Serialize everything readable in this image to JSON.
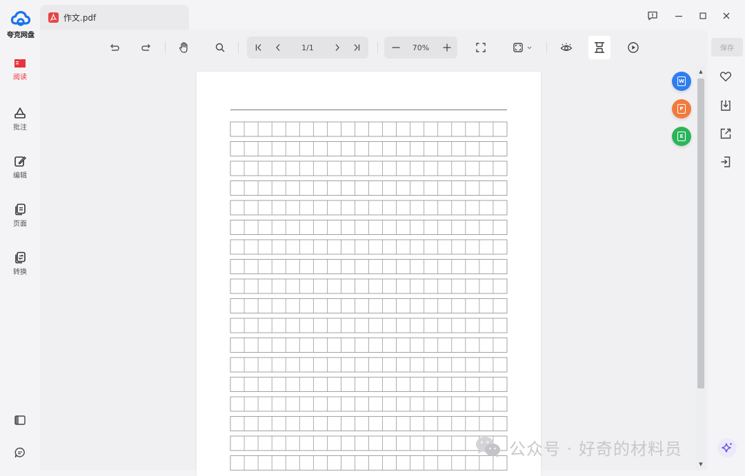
{
  "app": {
    "logo_text": "夸克网盘",
    "brand_color": "#1a73e8"
  },
  "tab": {
    "title": "作文.pdf"
  },
  "nav": {
    "items": [
      {
        "label": "阅读",
        "icon": "read-icon",
        "active": true
      },
      {
        "label": "批注",
        "icon": "annotate-icon",
        "active": false
      },
      {
        "label": "编辑",
        "icon": "edit-icon",
        "active": false
      },
      {
        "label": "页面",
        "icon": "pages-icon",
        "active": false
      },
      {
        "label": "转换",
        "icon": "convert-icon",
        "active": false
      }
    ],
    "bottom": [
      "sidebar-toggle-icon",
      "chat-icon"
    ]
  },
  "window": {
    "controls": [
      "feedback-icon",
      "minimize-icon",
      "maximize-icon",
      "close-icon"
    ]
  },
  "toolbar": {
    "page_indicator": "1/1",
    "zoom_level": "70%",
    "tools": [
      "undo-icon",
      "redo-icon",
      "hand-icon",
      "search-icon",
      "first-page-icon",
      "prev-page-icon",
      "next-page-icon",
      "last-page-icon",
      "zoom-out-icon",
      "zoom-in-icon",
      "fullscreen-icon",
      "fit-page-icon",
      "eye-protect-icon",
      "fit-width-icon",
      "play-icon"
    ]
  },
  "document": {
    "grid_rows": 18,
    "grid_cols": 20
  },
  "right_panel": {
    "save_label": "保存",
    "icons": [
      "favorite-icon",
      "download-icon",
      "share-icon",
      "export-icon"
    ]
  },
  "floating_actions": [
    {
      "name": "to-word-button",
      "color": "#2f7ef0",
      "glyph": "W"
    },
    {
      "name": "to-pdf-button",
      "color": "#f27a3d",
      "glyph": "P"
    },
    {
      "name": "to-excel-button",
      "color": "#2bb55a",
      "glyph": "E"
    }
  ],
  "watermark": {
    "text": "公众号 · 好奇的材料员"
  },
  "colors": {
    "accent_red": "#e8333a",
    "page_background": "#ffffff",
    "grid_line": "#8a8a8a"
  }
}
